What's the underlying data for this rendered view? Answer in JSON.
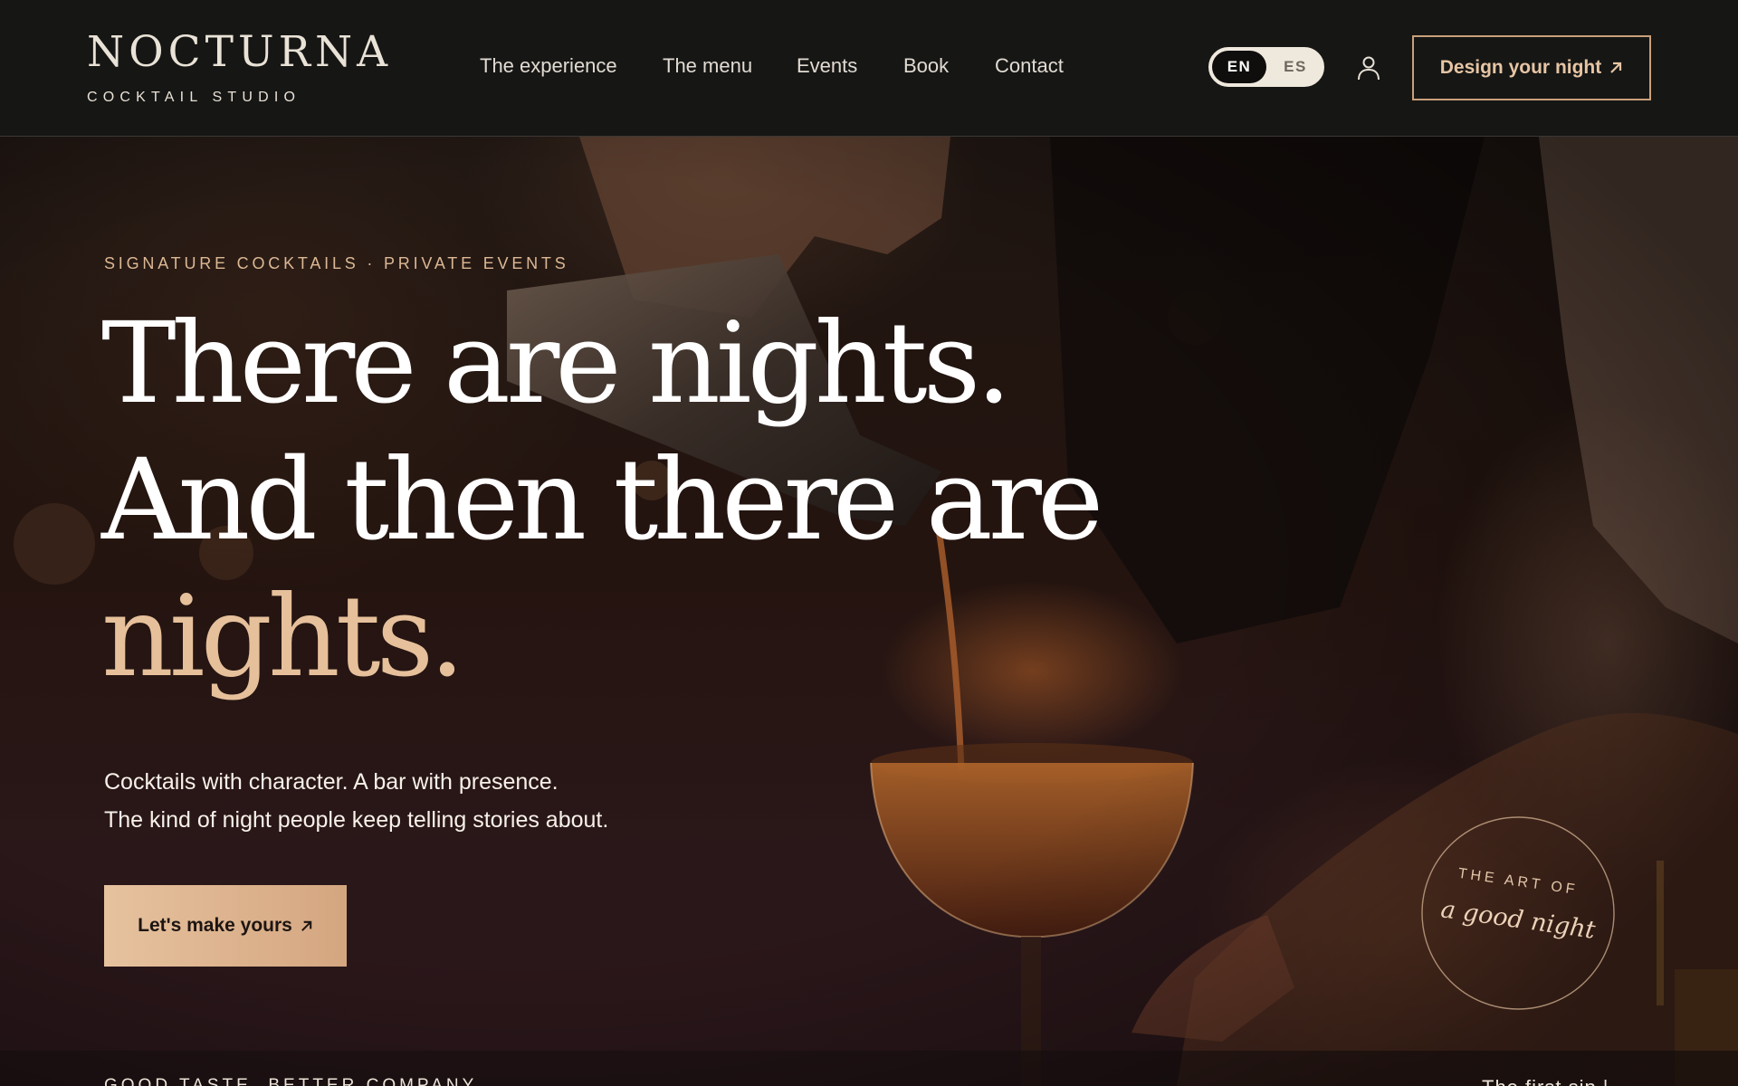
{
  "brand": {
    "name": "NOCTURNA",
    "tagline": "COCKTAIL STUDIO"
  },
  "nav": {
    "items": [
      {
        "label": "The experience"
      },
      {
        "label": "The menu"
      },
      {
        "label": "Events"
      },
      {
        "label": "Book"
      },
      {
        "label": "Contact"
      }
    ]
  },
  "language": {
    "options": [
      "EN",
      "ES"
    ],
    "selected": "EN"
  },
  "header_cta": {
    "label": "Design your night",
    "icon": "arrow-up-right-icon"
  },
  "account": {
    "icon": "user-icon"
  },
  "hero": {
    "eyebrow": "SIGNATURE COCKTAILS · PRIVATE EVENTS",
    "headline": {
      "line1": "There are nights.",
      "line2": "And then there are",
      "line3": "nights."
    },
    "subtext": {
      "line1": "Cocktails with character. A bar with presence.",
      "line2": "The kind of night people keep telling stories about."
    },
    "cta": {
      "label": "Let's make yours",
      "icon": "arrow-up-right-icon"
    },
    "badge": {
      "line1": "THE ART OF",
      "line2": "a good night"
    }
  },
  "below_fold": {
    "left": "GOOD TASTE. BETTER COMPANY.",
    "right": "The first sip |"
  },
  "colors": {
    "accent": "#e6c09b",
    "background": "#161615",
    "cta_fill": "#deb590",
    "text": "#ffffff"
  }
}
